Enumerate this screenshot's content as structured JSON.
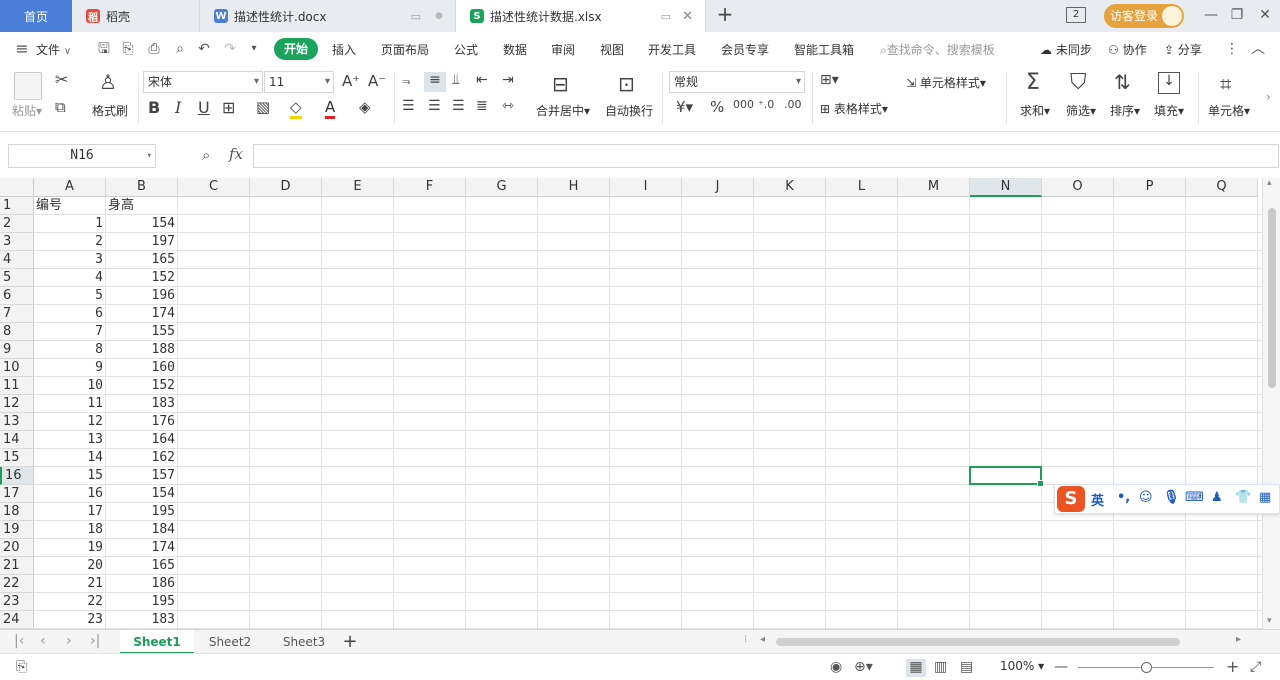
{
  "tabs": {
    "home": "首页",
    "docs": [
      {
        "label": "稻壳",
        "icon": "docer-icon",
        "color": "#e84d3c"
      },
      {
        "label": "描述性统计.docx",
        "icon": "word-icon",
        "color": "#4a7ed8"
      },
      {
        "label": "描述性统计数据.xlsx",
        "icon": "sheet-icon",
        "color": "#1aa35a"
      }
    ],
    "count_badge": "2",
    "login": "访客登录"
  },
  "menu": {
    "file": "文件",
    "start": "开始",
    "items": [
      "插入",
      "页面布局",
      "公式",
      "数据",
      "审阅",
      "视图",
      "开发工具",
      "会员专享",
      "智能工具箱"
    ],
    "search_placeholder": "查找命令、搜索模板",
    "sync": "未同步",
    "collab": "协作",
    "share": "分享"
  },
  "ribbon": {
    "paste": "粘贴",
    "format_painter": "格式刷",
    "font": "宋体",
    "font_size": "11",
    "merge": "合并居中",
    "wrap": "自动换行",
    "number_format": "常规",
    "cell_style": "单元格样式",
    "table_style": "表格样式",
    "sum": "求和",
    "filter": "筛选",
    "sort": "排序",
    "fill": "填充",
    "cell": "单元格"
  },
  "formula_bar": {
    "name_box": "N16",
    "fx": "fx",
    "content": ""
  },
  "grid": {
    "columns": [
      "A",
      "B",
      "C",
      "D",
      "E",
      "F",
      "G",
      "H",
      "I",
      "J",
      "K",
      "L",
      "M",
      "N",
      "O",
      "P",
      "Q"
    ],
    "selected_column": "N",
    "selected_row": 16,
    "headers": [
      "编号",
      "身高"
    ],
    "rows": [
      [
        1,
        154
      ],
      [
        2,
        197
      ],
      [
        3,
        165
      ],
      [
        4,
        152
      ],
      [
        5,
        196
      ],
      [
        6,
        174
      ],
      [
        7,
        155
      ],
      [
        8,
        188
      ],
      [
        9,
        160
      ],
      [
        10,
        152
      ],
      [
        11,
        183
      ],
      [
        12,
        176
      ],
      [
        13,
        164
      ],
      [
        14,
        162
      ],
      [
        15,
        157
      ],
      [
        16,
        154
      ],
      [
        17,
        195
      ],
      [
        18,
        184
      ],
      [
        19,
        174
      ],
      [
        20,
        165
      ],
      [
        21,
        186
      ],
      [
        22,
        195
      ],
      [
        23,
        183
      ]
    ]
  },
  "sheets": {
    "tabs": [
      "Sheet1",
      "Sheet2",
      "Sheet3"
    ],
    "active": "Sheet1"
  },
  "status": {
    "zoom": "100%",
    "zoom_level": 0.5
  },
  "ime": {
    "mode": "英",
    "logo": "S"
  }
}
